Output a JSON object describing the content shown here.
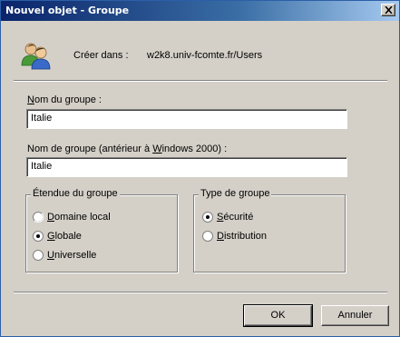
{
  "window": {
    "title": "Nouvel objet - Groupe"
  },
  "create_in": {
    "label": "Créer dans :",
    "value": "w2k8.univ-fcomte.fr/Users"
  },
  "group_name": {
    "label_accel": "N",
    "label_rest": "om du groupe :",
    "value": "Italie"
  },
  "group_name_pre2000": {
    "label_before": "Nom de groupe (antérieur à ",
    "label_accel": "W",
    "label_after": "indows 2000) :",
    "value": "Italie"
  },
  "scope": {
    "title": "Étendue du groupe",
    "options": [
      {
        "accel": "D",
        "rest": "omaine local",
        "selected": false
      },
      {
        "accel": "G",
        "rest": "lobale",
        "selected": true
      },
      {
        "accel": "U",
        "rest": "niverselle",
        "selected": false
      }
    ]
  },
  "type": {
    "title": "Type de groupe",
    "options": [
      {
        "accel": "S",
        "rest": "écurité",
        "selected": true
      },
      {
        "accel": "D",
        "rest": "istribution",
        "selected": false
      }
    ]
  },
  "buttons": {
    "ok": "OK",
    "cancel": "Annuler"
  }
}
